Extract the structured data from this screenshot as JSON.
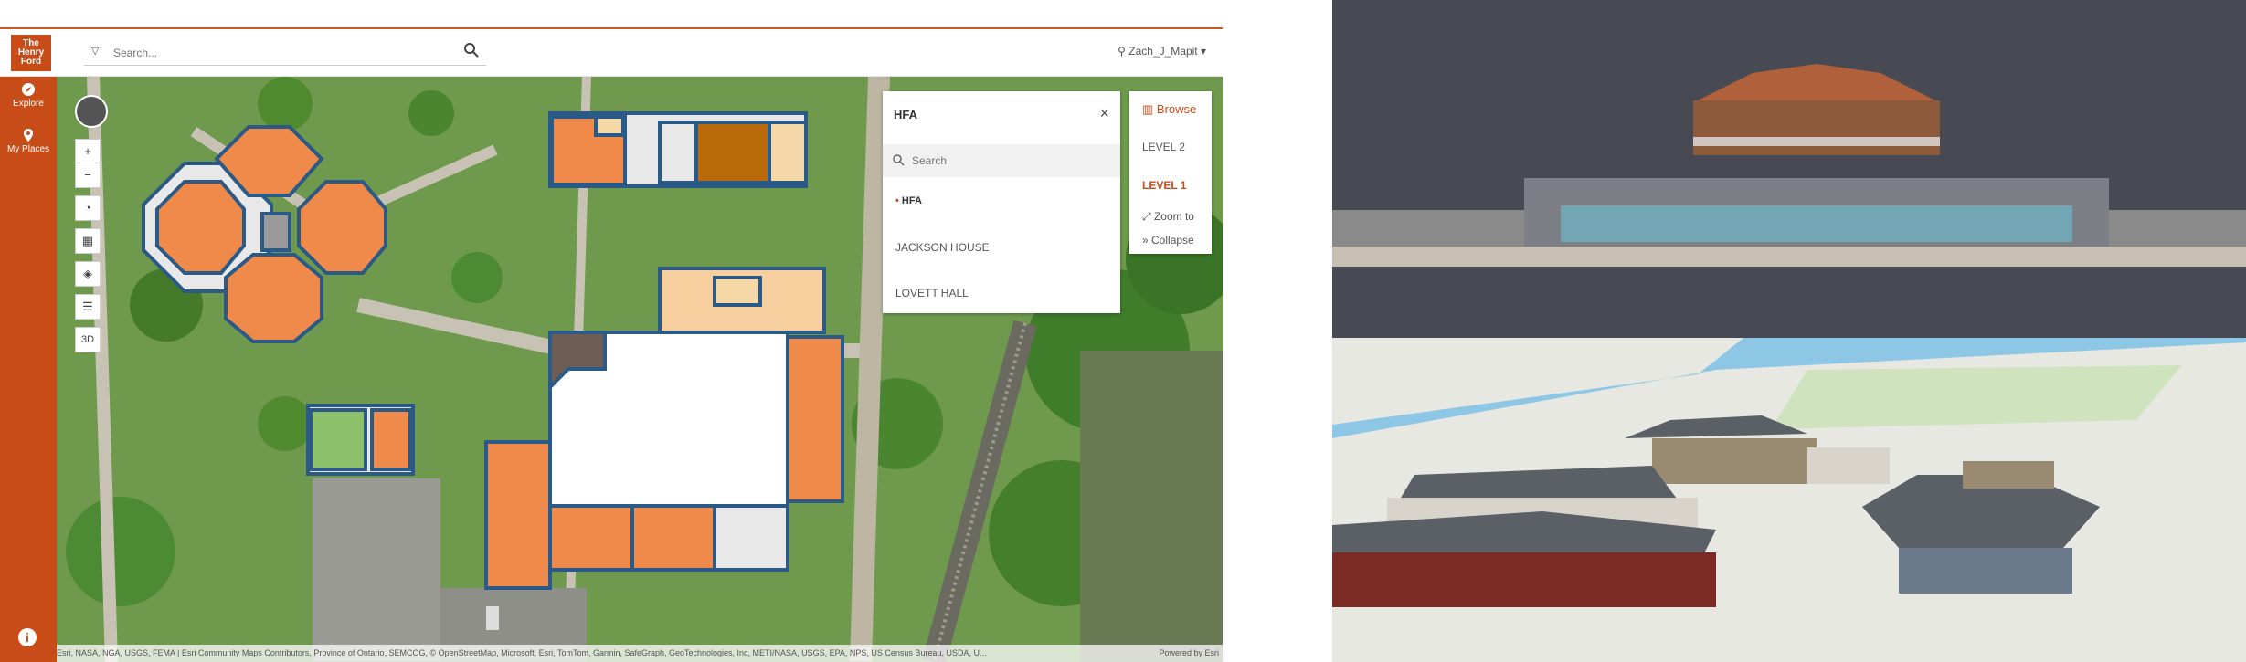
{
  "header": {
    "logo_text": "The\nHenry\nFord",
    "search_placeholder": "Search...",
    "user_name": "Zach_J_Mapit ▾"
  },
  "sidebar": {
    "items": [
      {
        "label": "Explore",
        "icon": "explore-icon"
      },
      {
        "label": "My Places",
        "icon": "map-pin-icon"
      }
    ],
    "info_icon": "i"
  },
  "map_tools": [
    "+",
    "−",
    "◔",
    "▦",
    "◈",
    "☰",
    "3D"
  ],
  "facility_panel": {
    "title": "HFA",
    "search_placeholder": "Search",
    "facilities": [
      {
        "label": "HFA",
        "selected": true
      },
      {
        "label": "JACKSON HOUSE",
        "selected": false
      },
      {
        "label": "LOVETT HALL",
        "selected": false
      }
    ]
  },
  "level_panel": {
    "browse_label": "Browse",
    "levels": [
      {
        "label": "LEVEL 2",
        "selected": false
      },
      {
        "label": "LEVEL 1",
        "selected": true
      }
    ],
    "zoom_label": "Zoom to",
    "collapse_label": "Collapse"
  },
  "attribution": {
    "text": "Esri, NASA, NGA, USGS, FEMA | Esri Community Maps Contributors, Province of Ontario, SEMCOG, © OpenStreetMap, Microsoft, Esri, TomTom, Garmin, SafeGraph, GeoTechnologies, Inc, METI/NASA, USGS, EPA, NPS, US Census Bureau, USDA, U...",
    "powered": "Powered by Esri"
  },
  "colors": {
    "brand": "#c84c18",
    "room_fill": "#f08a4b",
    "building_outline": "#2c5a86",
    "pointcloud_bg": "#474a52",
    "model_bg": "#e8e8e2"
  }
}
